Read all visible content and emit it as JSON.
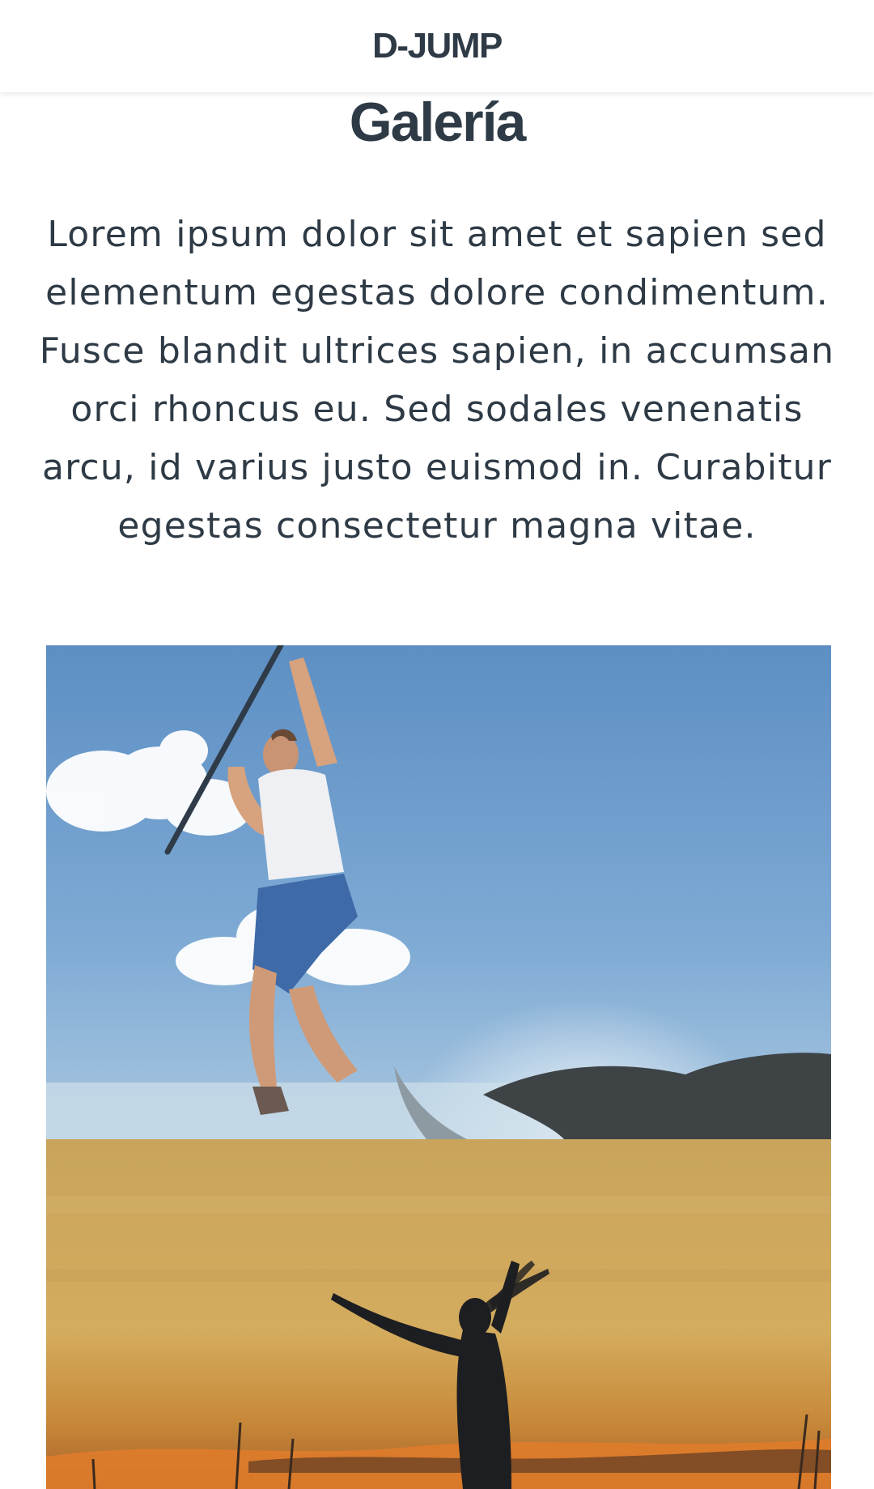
{
  "header": {
    "brand": "D-JUMP"
  },
  "page": {
    "title": "Galería",
    "intro": "Lorem ipsum dolor sit amet et sapien sed elementum egestas dolore condimentum. Fusce blandit ultrices sapien, in accumsan orci rhoncus eu. Sed sodales venenatis arcu, id varius justo euismod in. Curabitur egestas consectetur magna vitae."
  },
  "gallery": {
    "items": [
      {
        "subject": "person jumping over a whale in the sea"
      },
      {
        "subject": "silhouette of a woman at sunset"
      }
    ]
  },
  "colors": {
    "text": "#2e3a45",
    "background": "#ffffff",
    "sky_blue": "#6f9fcb",
    "sunset_gold": "#caa45a"
  }
}
